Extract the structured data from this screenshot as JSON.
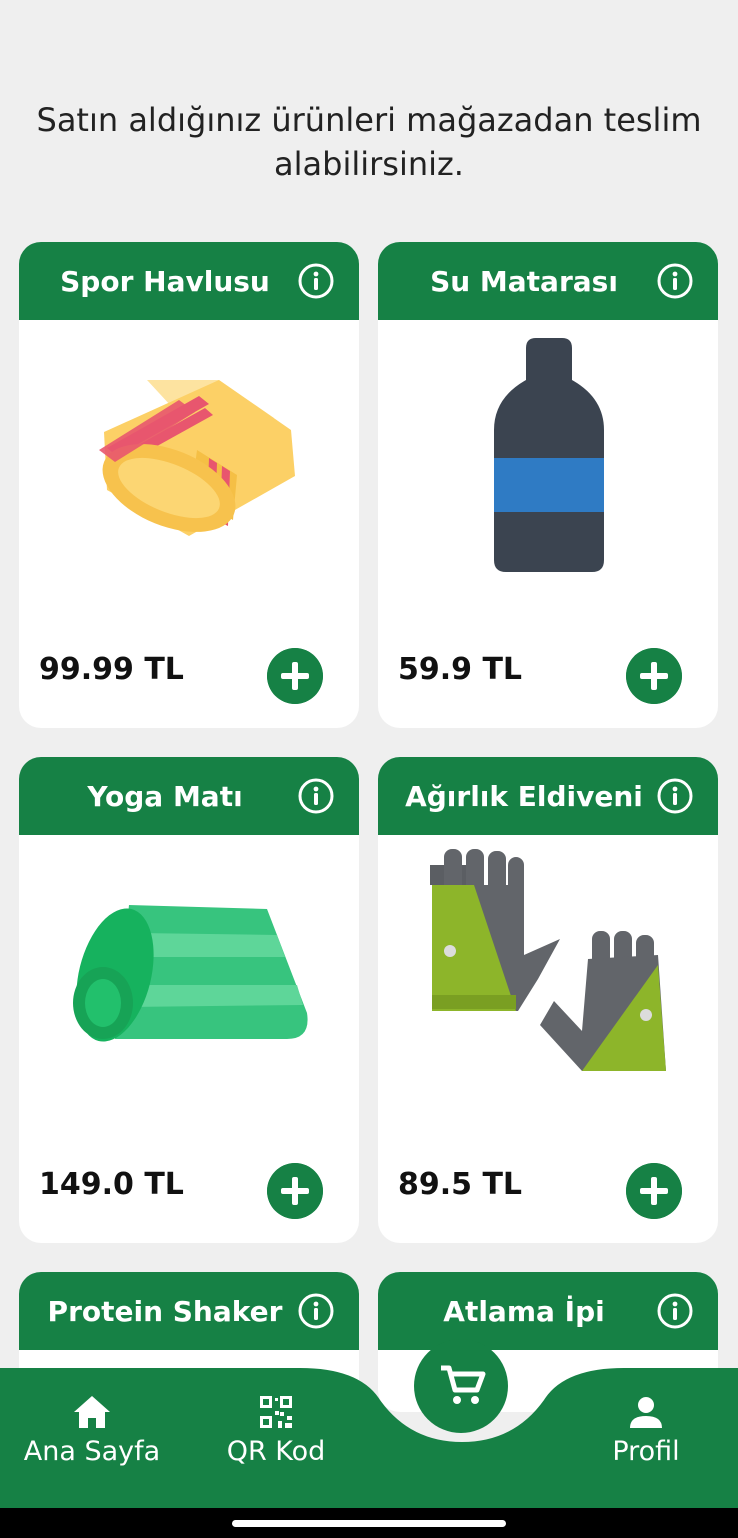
{
  "intro": "Satın aldığınız ürünleri mağazadan teslim alabilirsiniz.",
  "products": [
    {
      "name": "Spor Havlusu",
      "price": "99.99 TL",
      "icon": "towel-icon"
    },
    {
      "name": "Su Matarası",
      "price": "59.9 TL",
      "icon": "bottle-icon"
    },
    {
      "name": "Yoga Matı",
      "price": "149.0 TL",
      "icon": "yoga-mat-icon"
    },
    {
      "name": "Ağırlık Eldiveni",
      "price": "89.5 TL",
      "icon": "gloves-icon"
    },
    {
      "name": "Protein Shaker",
      "price": "",
      "icon": ""
    },
    {
      "name": "Atlama İpi",
      "price": "",
      "icon": ""
    }
  ],
  "nav": {
    "home": "Ana Sayfa",
    "qr": "QR Kod",
    "profile": "Profil",
    "cart_icon": "cart-icon"
  },
  "colors": {
    "accent": "#168145",
    "background": "#efefef"
  }
}
